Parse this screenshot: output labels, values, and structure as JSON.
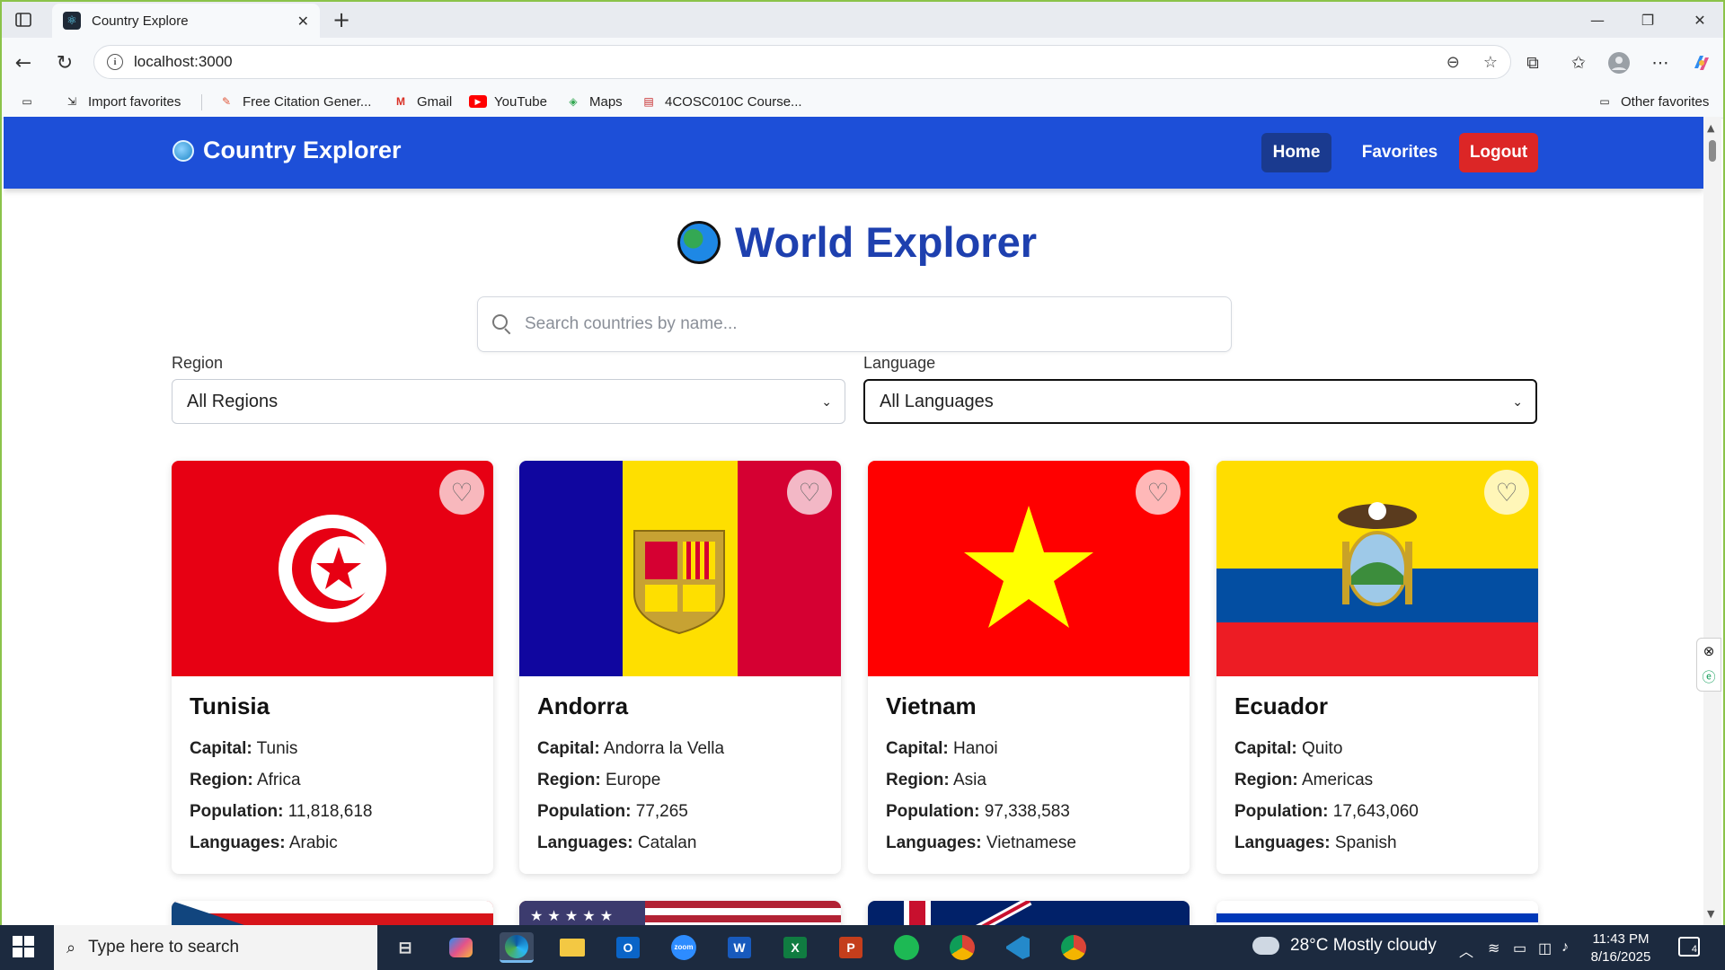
{
  "browser": {
    "tab_title": "Country Explore",
    "url": "localhost:3000",
    "favorites": [
      {
        "label": "Import favorites",
        "icon": "import-icon"
      },
      {
        "label": "Free Citation Gener...",
        "icon": "citation-icon"
      },
      {
        "label": "Gmail",
        "icon": "gmail-icon"
      },
      {
        "label": "YouTube",
        "icon": "youtube-icon"
      },
      {
        "label": "Maps",
        "icon": "maps-icon"
      },
      {
        "label": "4COSC010C Course...",
        "icon": "pdf-icon"
      }
    ],
    "other_favorites": "Other favorites"
  },
  "app": {
    "brand": "Country Explorer",
    "nav": {
      "home": "Home",
      "favorites": "Favorites",
      "logout": "Logout"
    },
    "title": "World Explorer",
    "search_placeholder": "Search countries by name...",
    "region_label": "Region",
    "region_value": "All Regions",
    "language_label": "Language",
    "language_value": "All Languages",
    "field_labels": {
      "capital": "Capital:",
      "region": "Region:",
      "population": "Population:",
      "languages": "Languages:"
    },
    "countries": [
      {
        "name": "Tunisia",
        "capital": "Tunis",
        "region": "Africa",
        "population": "11,818,618",
        "languages": "Arabic",
        "flag": "tunisia-flag"
      },
      {
        "name": "Andorra",
        "capital": "Andorra la Vella",
        "region": "Europe",
        "population": "77,265",
        "languages": "Catalan",
        "flag": "andorra-flag"
      },
      {
        "name": "Vietnam",
        "capital": "Hanoi",
        "region": "Asia",
        "population": "97,338,583",
        "languages": "Vietnamese",
        "flag": "vietnam-flag"
      },
      {
        "name": "Ecuador",
        "capital": "Quito",
        "region": "Americas",
        "population": "17,643,060",
        "languages": "Spanish",
        "flag": "ecuador-flag"
      }
    ]
  },
  "taskbar": {
    "search_placeholder": "Type here to search",
    "weather": "28°C  Mostly cloudy",
    "time": "11:43 PM",
    "date": "8/16/2025",
    "notifications": "4"
  },
  "colors": {
    "navbar": "#1d4fd8",
    "title": "#1e40af",
    "home_active": "#1a3a8f",
    "logout": "#dc2626"
  }
}
